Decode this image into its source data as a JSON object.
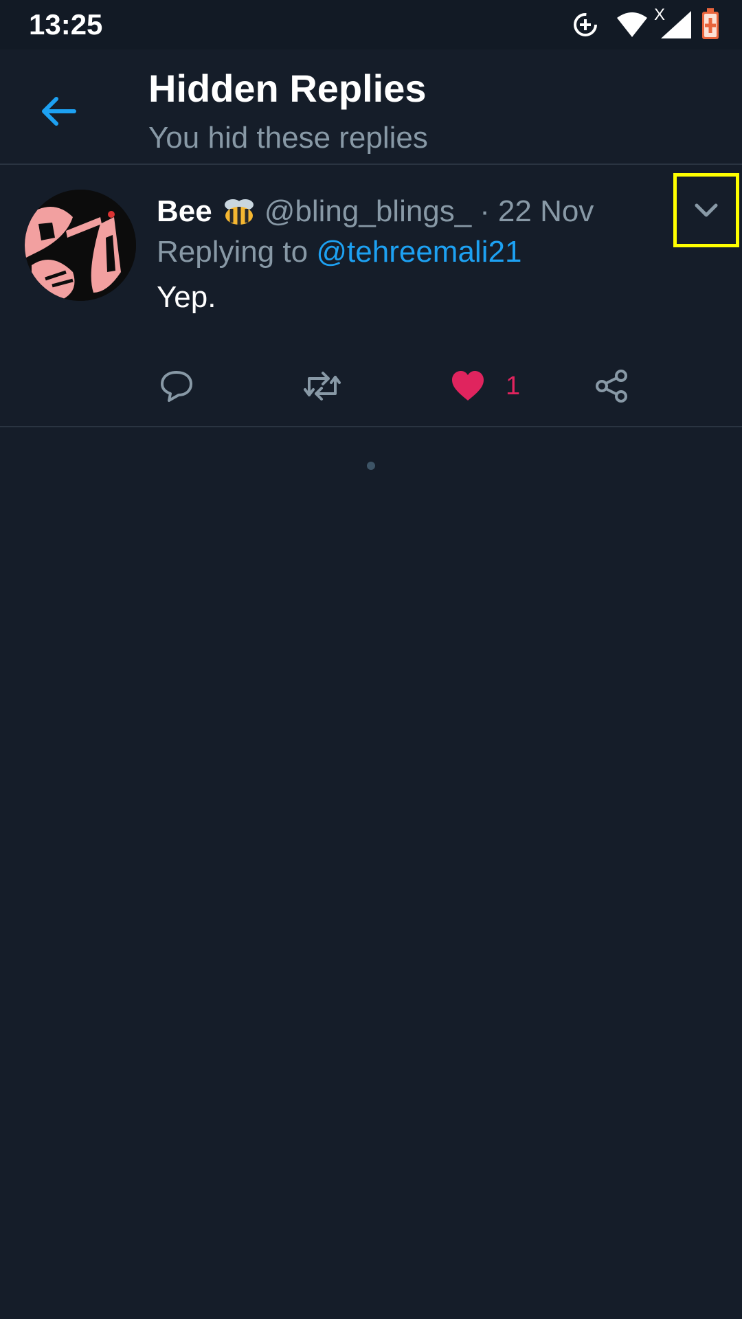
{
  "status_bar": {
    "time": "13:25",
    "icons": [
      "data-saver-icon",
      "wifi-icon",
      "signal-no-data-icon",
      "battery-charging-icon"
    ],
    "signal_mark": "X"
  },
  "header": {
    "title": "Hidden Replies",
    "subtitle": "You hid these replies",
    "back_icon": "arrow-left-icon",
    "accent_color": "#1da1f2"
  },
  "reply": {
    "display_name": "Bee",
    "name_emoji": "bee-emoji-icon",
    "handle": "@bling_blings_",
    "separator": "·",
    "date": "22 Nov",
    "replying_prefix": "Replying to",
    "replying_to": "@tehreemali21",
    "text": "Yep.",
    "actions": {
      "reply_icon": "reply-bubble-icon",
      "retweet_icon": "retweet-icon",
      "like_icon": "heart-filled-icon",
      "like_count": "1",
      "share_icon": "share-icon"
    },
    "menu_icon": "chevron-down-icon",
    "like_color": "#e0245e"
  },
  "colors": {
    "background": "#151d29",
    "secondary_text": "#8899a6",
    "divider": "#2a3441",
    "highlight": "#ffff00"
  }
}
